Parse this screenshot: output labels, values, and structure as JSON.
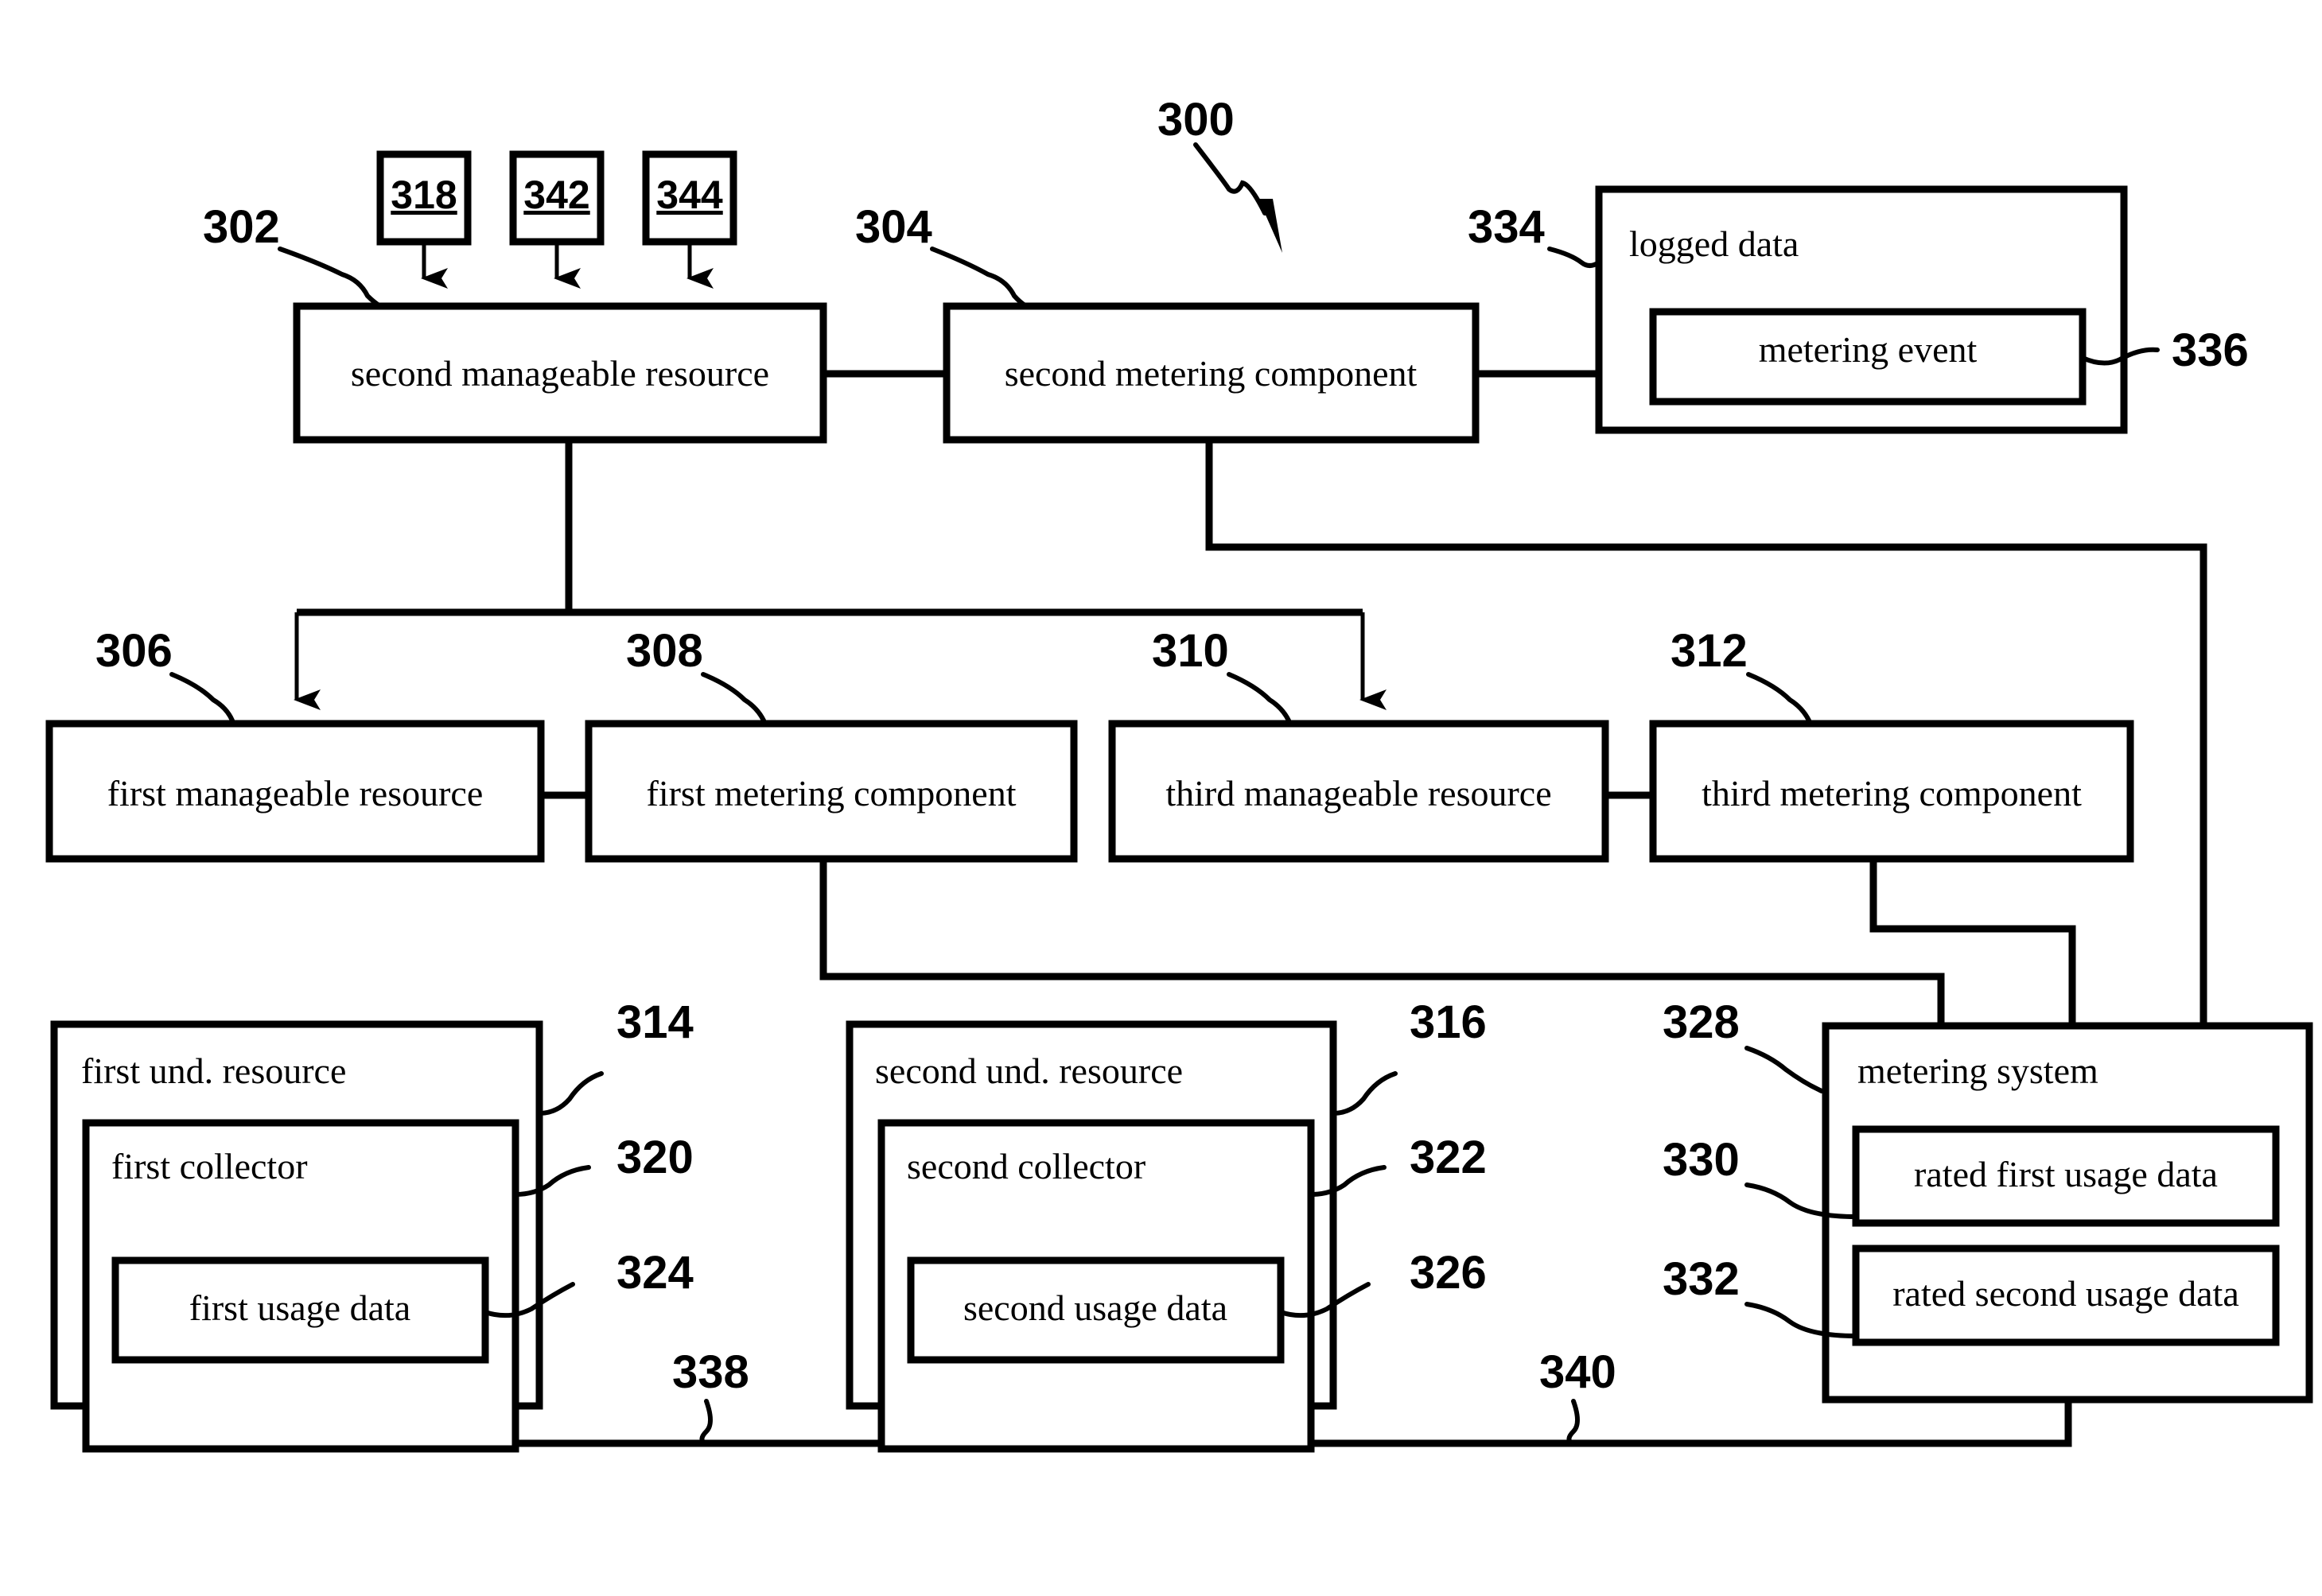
{
  "figure": {
    "reference_numeral": "300",
    "style": "patent block diagram"
  },
  "tag_boxes": [
    {
      "id": "tag-318",
      "label": "318"
    },
    {
      "id": "tag-342",
      "label": "342"
    },
    {
      "id": "tag-344",
      "label": "344"
    }
  ],
  "blocks": {
    "second_manageable_resource": {
      "label": "second manageable resource",
      "ref": "302"
    },
    "second_metering_component": {
      "label": "second metering component",
      "ref": "304"
    },
    "logged_data": {
      "label": "logged data",
      "ref": "334"
    },
    "metering_event": {
      "label": "metering event",
      "ref": "336"
    },
    "first_manageable_resource": {
      "label": "first manageable resource",
      "ref": "306"
    },
    "first_metering_component": {
      "label": "first metering component",
      "ref": "308"
    },
    "third_manageable_resource": {
      "label": "third manageable resource",
      "ref": "310"
    },
    "third_metering_component": {
      "label": "third metering component",
      "ref": "312"
    },
    "first_und_resource": {
      "label": "first und. resource",
      "ref": "314"
    },
    "first_collector": {
      "label": "first collector",
      "ref": "320"
    },
    "first_usage_data": {
      "label": "first usage data",
      "ref": "324"
    },
    "second_und_resource": {
      "label": "second und. resource",
      "ref": "316"
    },
    "second_collector": {
      "label": "second collector",
      "ref": "322"
    },
    "second_usage_data": {
      "label": "second usage data",
      "ref": "326"
    },
    "metering_system": {
      "label": "metering system",
      "ref": "328"
    },
    "rated_first_usage_data": {
      "label": "rated first usage data",
      "ref": "330"
    },
    "rated_second_usage_data": {
      "label": "rated second usage data",
      "ref": "332"
    }
  },
  "bus_refs": {
    "left_bus": "338",
    "right_bus": "340"
  },
  "colors": {
    "stroke": "#000000",
    "background": "#ffffff"
  }
}
